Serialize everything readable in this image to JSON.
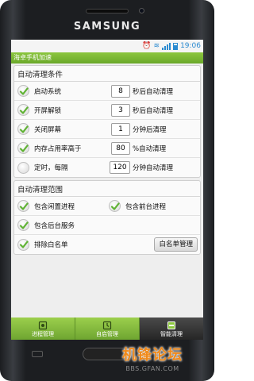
{
  "device": {
    "brand": "SAMSUNG"
  },
  "status_bar": {
    "time": "19:06"
  },
  "app": {
    "title": "海卓手机加速"
  },
  "auto_clean_conditions": {
    "title": "自动清理条件",
    "rows": [
      {
        "label": "启动系统",
        "value": "8",
        "suffix": "秒后自动清理",
        "checked": true
      },
      {
        "label": "开屏解锁",
        "value": "3",
        "suffix": "秒后自动清理",
        "checked": true
      },
      {
        "label": "关闭屏幕",
        "value": "1",
        "suffix": "分钟后清理",
        "checked": true
      },
      {
        "label": "内存占用率高于",
        "value": "80",
        "suffix": "%自动清理",
        "checked": true
      },
      {
        "label": "定时，每隔",
        "value": "120",
        "suffix": "分钟自动清理",
        "checked": false
      }
    ]
  },
  "auto_clean_scope": {
    "title": "自动清理范围",
    "include_idle": {
      "label": "包含闲置进程",
      "checked": true
    },
    "include_foreground": {
      "label": "包含前台进程",
      "checked": true
    },
    "include_background_services": {
      "label": "包含后台服务",
      "checked": true
    },
    "exclude_whitelist": {
      "label": "排除白名单",
      "checked": true
    },
    "whitelist_button": "白名单管理"
  },
  "tabs": [
    {
      "label": "进程管理",
      "active": false
    },
    {
      "label": "自启管理",
      "active": false
    },
    {
      "label": "智能清理",
      "active": true
    }
  ],
  "watermark": {
    "main": "机锋论坛",
    "sub": "BBS.GFAN.COM"
  },
  "colors": {
    "accent_green": "#7ab536",
    "check_green": "#5fb233",
    "active_tab": "#333333"
  }
}
